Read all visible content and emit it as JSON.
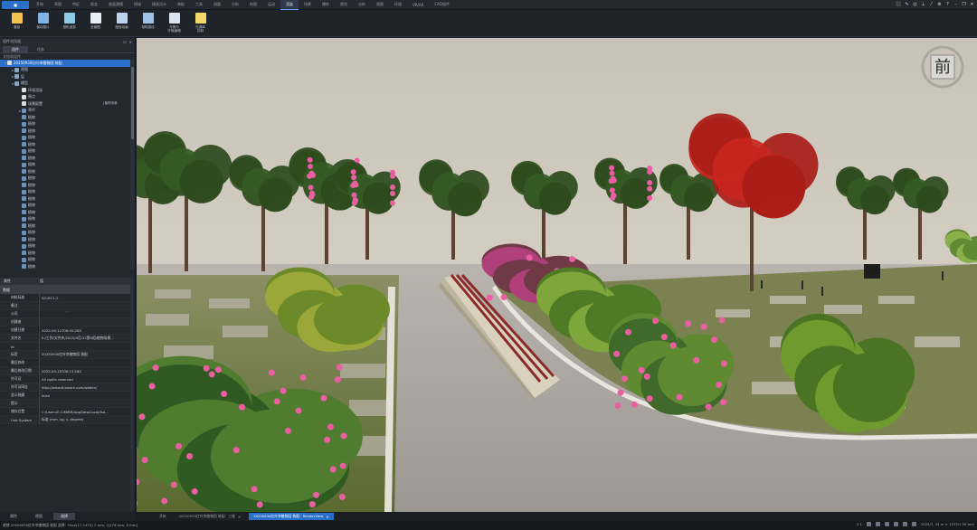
{
  "menu": {
    "tabs": [
      "开始",
      "草图",
      "特征",
      "钣金",
      "曲面建模",
      "焊接",
      "模具设计",
      "装配",
      "工具",
      "测量",
      "分析",
      "绘图",
      "运动",
      "渲染",
      "场景",
      "爆炸",
      "视觉",
      "分析",
      "视图",
      "环境",
      "VR/AR",
      "CAD插件"
    ],
    "active_index": 13
  },
  "ribbon": {
    "buttons": [
      {
        "label": "渲染",
        "icon": "render-icon",
        "color": "#f2c14e"
      },
      {
        "label": "保存图片",
        "icon": "save-image-icon",
        "color": "#7fb3e6"
      },
      {
        "label": "相机漫游",
        "icon": "camera-tour-icon",
        "color": "#8ecae6"
      },
      {
        "label": "全景图",
        "icon": "panorama-icon",
        "color": "#e6eef7"
      },
      {
        "label": "路径动画",
        "icon": "path-animation-icon",
        "color": "#bcd4ee"
      },
      {
        "label": "相机路径",
        "icon": "camera-path-icon",
        "color": "#9fc3e8"
      },
      {
        "label": "光照与\n环境编辑",
        "icon": "lighting-edit-icon",
        "color": "#d9e4f0"
      },
      {
        "label": "光源库\n控制",
        "icon": "light-source-icon",
        "color": "#f5d86b"
      }
    ]
  },
  "left_panel": {
    "title": "组件浏览器",
    "tabs": [
      "组件",
      "任务"
    ],
    "active_tab": 0,
    "tree_header": "文档和组件",
    "tree": [
      {
        "label": "20250930红叶李植物园 装配",
        "indent": 0,
        "twisty": "▾",
        "icon": "doc",
        "selected": true
      },
      {
        "label": "视图",
        "indent": 1,
        "twisty": "▸",
        "icon": "folder"
      },
      {
        "label": "层",
        "indent": 1,
        "twisty": "▸",
        "icon": "folder"
      },
      {
        "label": "模型",
        "indent": 1,
        "twisty": "▾",
        "icon": "folder"
      },
      {
        "label": "环境渲染",
        "indent": 2,
        "twisty": "",
        "icon": "doc"
      },
      {
        "label": "原点",
        "indent": 2,
        "twisty": "",
        "icon": "doc"
      },
      {
        "label": "场景配置",
        "indent": 2,
        "twisty": "",
        "icon": "doc",
        "extra": "[植物场景"
      },
      {
        "label": "草坪",
        "indent": 2,
        "twisty": "▸",
        "icon": "cube"
      },
      {
        "label": "植物",
        "indent": 2,
        "twisty": "",
        "icon": "cube"
      },
      {
        "label": "植物",
        "indent": 2,
        "twisty": "",
        "icon": "cube"
      },
      {
        "label": "植物",
        "indent": 2,
        "twisty": "",
        "icon": "cube"
      },
      {
        "label": "植物",
        "indent": 2,
        "twisty": "",
        "icon": "cube"
      },
      {
        "label": "植物",
        "indent": 2,
        "twisty": "",
        "icon": "cube"
      },
      {
        "label": "植物",
        "indent": 2,
        "twisty": "",
        "icon": "cube"
      },
      {
        "label": "植物",
        "indent": 2,
        "twisty": "",
        "icon": "cube"
      },
      {
        "label": "植物",
        "indent": 2,
        "twisty": "",
        "icon": "cube"
      },
      {
        "label": "植物",
        "indent": 2,
        "twisty": "",
        "icon": "cube"
      },
      {
        "label": "植物",
        "indent": 2,
        "twisty": "",
        "icon": "cube"
      },
      {
        "label": "植物",
        "indent": 2,
        "twisty": "",
        "icon": "cube"
      },
      {
        "label": "植物",
        "indent": 2,
        "twisty": "",
        "icon": "cube"
      },
      {
        "label": "植物",
        "indent": 2,
        "twisty": "",
        "icon": "cube"
      },
      {
        "label": "植物",
        "indent": 2,
        "twisty": "",
        "icon": "cube"
      },
      {
        "label": "植物",
        "indent": 2,
        "twisty": "",
        "icon": "cube"
      },
      {
        "label": "植物",
        "indent": 2,
        "twisty": "",
        "icon": "cube"
      },
      {
        "label": "植物",
        "indent": 2,
        "twisty": "",
        "icon": "cube"
      },
      {
        "label": "植物",
        "indent": 2,
        "twisty": "",
        "icon": "cube"
      },
      {
        "label": "植物",
        "indent": 2,
        "twisty": "",
        "icon": "cube"
      },
      {
        "label": "植物",
        "indent": 2,
        "twisty": "",
        "icon": "cube"
      },
      {
        "label": "植物",
        "indent": 2,
        "twisty": "",
        "icon": "cube"
      },
      {
        "label": "植物",
        "indent": 2,
        "twisty": "",
        "icon": "cube"
      },
      {
        "label": "植物",
        "indent": 2,
        "twisty": "",
        "icon": "cube"
      }
    ],
    "splitter": "....."
  },
  "properties": {
    "header_name": "属性",
    "header_value": "值",
    "group": "数据",
    "rows": [
      {
        "name": "材料标准",
        "value": "SZ-IEC1.2"
      },
      {
        "name": "备注",
        "value": ""
      },
      {
        "name": "公司",
        "value": ""
      },
      {
        "name": "创建者",
        "value": ""
      },
      {
        "name": "创建日期",
        "value": "2025-09-12T06:05:26Z"
      },
      {
        "name": "文件名",
        "value": "E:/工作/文件夹/2025/9月/12第9组/植物场景..."
      },
      {
        "name": "Id",
        "value": ""
      },
      {
        "name": "标签",
        "value": "20250930红叶李植物园 装配"
      },
      {
        "name": "最后修改",
        "value": ""
      },
      {
        "name": "最后修改日期",
        "value": "2025-09-29T08:13:18Z"
      },
      {
        "name": "许可证",
        "value": "All rights reserved"
      },
      {
        "name": "许可证网址",
        "value": "http://www.thsware.com/webim/"
      },
      {
        "name": "显示隐藏",
        "value": "false"
      },
      {
        "name": "提示",
        "value": ""
      },
      {
        "name": "储存位置",
        "value": "C:/Users/E-CIMIRR/AppData/Local/tsa..."
      },
      {
        "name": "Unit System",
        "value": "标准 (mm, kg, s, degree)"
      }
    ]
  },
  "left_bottom_tabs": [
    "属性",
    "视图",
    "选择"
  ],
  "left_bottom_active": 2,
  "doc_tabs": [
    {
      "label": "开始",
      "active": false
    },
    {
      "label": "20250930红叶李植物园 装配：三维",
      "active": false
    },
    {
      "label": "20250930红叶李植物园 装配：RenderView",
      "active": true
    }
  ],
  "navcube_label": "前",
  "status": {
    "left": "就绪  20250930红叶李植物园 装配 选择：Face(17-1475) 7 mm, 1[176 mm, 5 mm]",
    "scale": "1:1",
    "coords": "2025/7, 44 m × 1333/1 50 mm",
    "icons": [
      "grid-icon",
      "snap-icon",
      "ortho-icon",
      "layer-icon",
      "settings-icon",
      "cursor-icon"
    ]
  },
  "colors": {
    "accent": "#2a6fc9",
    "ui_bg": "#23272e",
    "sky": "#c8c2b6",
    "pavement": "#a9a49e",
    "grass": "#6f7a3a",
    "leaf_dark": "#355a24",
    "leaf_light": "#7fa63a",
    "pink_flower": "#e95fa1",
    "red_tree": "#c8261f"
  },
  "window_icons": [
    "select-icon",
    "pen-icon",
    "target-icon",
    "measure-icon",
    "line-icon",
    "settings-icon",
    "help-icon",
    "minimize-icon",
    "restore-icon",
    "close-icon"
  ]
}
